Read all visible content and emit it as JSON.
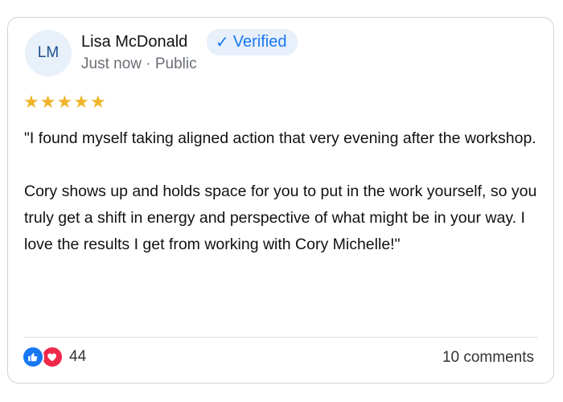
{
  "post": {
    "author": {
      "initials": "LM",
      "name": "Lisa McDonald",
      "badge": "Verified",
      "meta": "Just now · Public"
    },
    "rating": 5,
    "stars_display": "★★★★★",
    "text": {
      "paragraph1": "\"I found myself taking aligned action that very evening after the workshop.",
      "paragraph2": "Cory shows up and holds space for you to put in the work yourself, so you truly get a shift in energy and perspective of what might be in your way. I love the results I get from working with Cory Michelle!\""
    },
    "reactions": {
      "types": [
        "like-icon",
        "love-icon"
      ],
      "count": "44"
    },
    "comments_label": "10 comments"
  },
  "colors": {
    "accent": "#1877f2",
    "star": "#f0b429",
    "love": "#f0284a"
  }
}
